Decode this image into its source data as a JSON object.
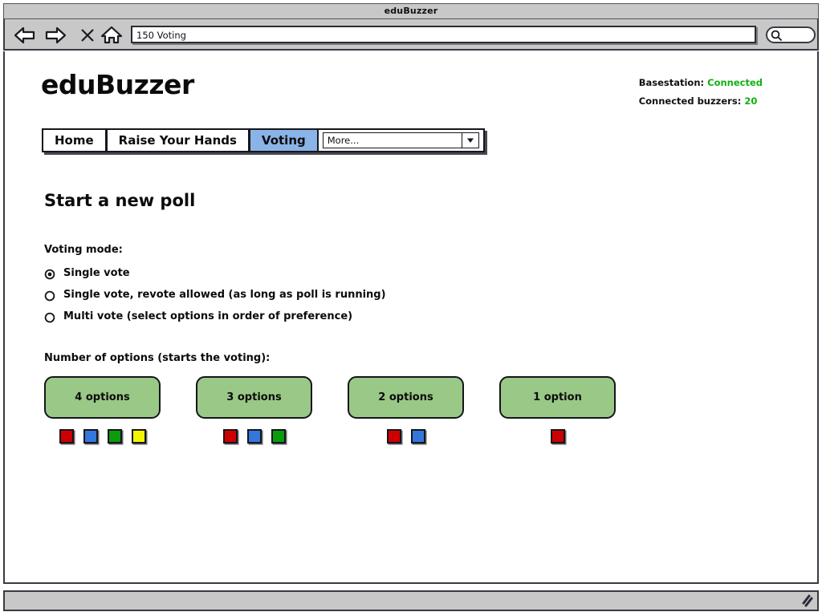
{
  "window": {
    "title": "eduBuzzer"
  },
  "browser": {
    "url_value": "150 Voting",
    "url_placeholder": "Enter address",
    "search_placeholder": "",
    "search_value": "",
    "nav": {
      "back": "back-icon",
      "forward": "forward-icon",
      "stop": "stop-icon",
      "home": "home-icon"
    },
    "search_icon": "search-icon",
    "resize_grip_icon": "resize-grip-icon"
  },
  "page": {
    "brand": "eduBuzzer",
    "status": {
      "basestation_label": "Basestation:",
      "basestation_value": "Connected",
      "buzzers_label": "Connected buzzers:",
      "buzzers_value": "20",
      "value_color": "#10b010"
    },
    "tabs": [
      {
        "label": "Home",
        "active": false
      },
      {
        "label": "Raise Your Hands",
        "active": false
      },
      {
        "label": "Voting",
        "active": true
      }
    ],
    "more_dropdown": {
      "selected": "More...",
      "arrow_icon": "chevron-down-icon"
    },
    "section_title": "Start a new poll",
    "voting_mode": {
      "label": "Voting mode:",
      "options": [
        {
          "label": "Single vote",
          "selected": true
        },
        {
          "label": "Single vote, revote allowed (as long as poll is running)",
          "selected": false
        },
        {
          "label": "Multi vote (select options in order of preference)",
          "selected": false
        }
      ]
    },
    "number_of_options": {
      "label": "Number of options (starts the voting):",
      "groups": [
        {
          "button_label": "4 options",
          "swatches": [
            "#cc0000",
            "#3377dd",
            "#0a9c0a",
            "#f4f400"
          ]
        },
        {
          "button_label": "3 options",
          "swatches": [
            "#cc0000",
            "#3377dd",
            "#0a9c0a"
          ]
        },
        {
          "button_label": "2 options",
          "swatches": [
            "#cc0000",
            "#3377dd"
          ]
        },
        {
          "button_label": "1 option",
          "swatches": [
            "#cc0000"
          ]
        }
      ],
      "button_color": "#9ac887"
    }
  }
}
